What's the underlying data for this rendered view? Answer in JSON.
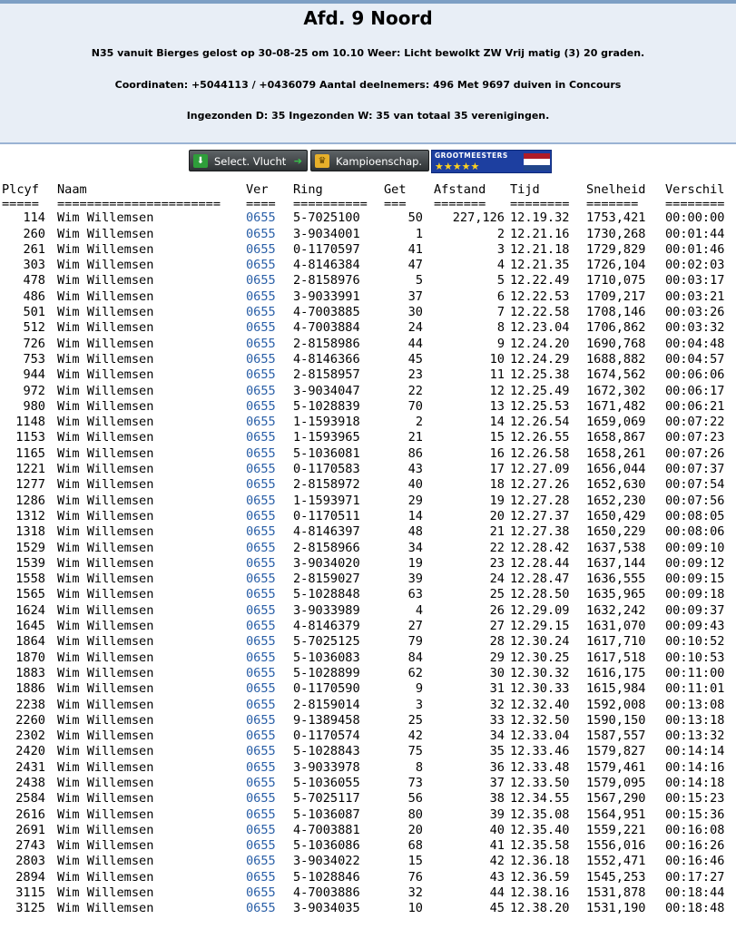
{
  "header": {
    "title": "Afd. 9 Noord",
    "line1": "N35 vanuit Bierges gelost op 30-08-25 om 10.10 Weer: Licht bewolkt ZW Vrij matig (3) 20 graden.",
    "line2": "Coordinaten: +5044113 / +0436079 Aantal deelnemers: 496 Met 9697 duiven in Concours",
    "line3": "Ingezonden D: 35 Ingezonden W: 35 van totaal 35 verenigingen."
  },
  "buttons": {
    "select": "Select. Vlucht",
    "kamp": "Kampioenschap.",
    "grootmeesters": "GROOTMEESTERS",
    "stars": "★★★★★"
  },
  "colors": {
    "header_bg": "#e8eef6",
    "ver_link": "#2a5fa7",
    "flag": [
      "#ae1c28",
      "#ffffff",
      "#21468b"
    ]
  },
  "table": {
    "headers": [
      "Plcyf",
      "Naam",
      "Ver",
      "Ring",
      "Get",
      "Afstand",
      "Tijd",
      "Snelheid",
      "Verschil"
    ],
    "separators": [
      "=====",
      "======================",
      "====",
      "==========",
      "===",
      "=======",
      "========",
      "=======",
      "========"
    ],
    "rows": [
      [
        "114",
        "Wim Willemsen",
        "0655",
        "5-7025100",
        "50",
        "227,126",
        "12.19.32",
        "1753,421",
        "00:00:00"
      ],
      [
        "260",
        "Wim Willemsen",
        "0655",
        "3-9034001",
        "1",
        "2",
        "12.21.16",
        "1730,268",
        "00:01:44"
      ],
      [
        "261",
        "Wim Willemsen",
        "0655",
        "0-1170597",
        "41",
        "3",
        "12.21.18",
        "1729,829",
        "00:01:46"
      ],
      [
        "303",
        "Wim Willemsen",
        "0655",
        "4-8146384",
        "47",
        "4",
        "12.21.35",
        "1726,104",
        "00:02:03"
      ],
      [
        "478",
        "Wim Willemsen",
        "0655",
        "2-8158976",
        "5",
        "5",
        "12.22.49",
        "1710,075",
        "00:03:17"
      ],
      [
        "486",
        "Wim Willemsen",
        "0655",
        "3-9033991",
        "37",
        "6",
        "12.22.53",
        "1709,217",
        "00:03:21"
      ],
      [
        "501",
        "Wim Willemsen",
        "0655",
        "4-7003885",
        "30",
        "7",
        "12.22.58",
        "1708,146",
        "00:03:26"
      ],
      [
        "512",
        "Wim Willemsen",
        "0655",
        "4-7003884",
        "24",
        "8",
        "12.23.04",
        "1706,862",
        "00:03:32"
      ],
      [
        "726",
        "Wim Willemsen",
        "0655",
        "2-8158986",
        "44",
        "9",
        "12.24.20",
        "1690,768",
        "00:04:48"
      ],
      [
        "753",
        "Wim Willemsen",
        "0655",
        "4-8146366",
        "45",
        "10",
        "12.24.29",
        "1688,882",
        "00:04:57"
      ],
      [
        "944",
        "Wim Willemsen",
        "0655",
        "2-8158957",
        "23",
        "11",
        "12.25.38",
        "1674,562",
        "00:06:06"
      ],
      [
        "972",
        "Wim Willemsen",
        "0655",
        "3-9034047",
        "22",
        "12",
        "12.25.49",
        "1672,302",
        "00:06:17"
      ],
      [
        "980",
        "Wim Willemsen",
        "0655",
        "5-1028839",
        "70",
        "13",
        "12.25.53",
        "1671,482",
        "00:06:21"
      ],
      [
        "1148",
        "Wim Willemsen",
        "0655",
        "1-1593918",
        "2",
        "14",
        "12.26.54",
        "1659,069",
        "00:07:22"
      ],
      [
        "1153",
        "Wim Willemsen",
        "0655",
        "1-1593965",
        "21",
        "15",
        "12.26.55",
        "1658,867",
        "00:07:23"
      ],
      [
        "1165",
        "Wim Willemsen",
        "0655",
        "5-1036081",
        "86",
        "16",
        "12.26.58",
        "1658,261",
        "00:07:26"
      ],
      [
        "1221",
        "Wim Willemsen",
        "0655",
        "0-1170583",
        "43",
        "17",
        "12.27.09",
        "1656,044",
        "00:07:37"
      ],
      [
        "1277",
        "Wim Willemsen",
        "0655",
        "2-8158972",
        "40",
        "18",
        "12.27.26",
        "1652,630",
        "00:07:54"
      ],
      [
        "1286",
        "Wim Willemsen",
        "0655",
        "1-1593971",
        "29",
        "19",
        "12.27.28",
        "1652,230",
        "00:07:56"
      ],
      [
        "1312",
        "Wim Willemsen",
        "0655",
        "0-1170511",
        "14",
        "20",
        "12.27.37",
        "1650,429",
        "00:08:05"
      ],
      [
        "1318",
        "Wim Willemsen",
        "0655",
        "4-8146397",
        "48",
        "21",
        "12.27.38",
        "1650,229",
        "00:08:06"
      ],
      [
        "1529",
        "Wim Willemsen",
        "0655",
        "2-8158966",
        "34",
        "22",
        "12.28.42",
        "1637,538",
        "00:09:10"
      ],
      [
        "1539",
        "Wim Willemsen",
        "0655",
        "3-9034020",
        "19",
        "23",
        "12.28.44",
        "1637,144",
        "00:09:12"
      ],
      [
        "1558",
        "Wim Willemsen",
        "0655",
        "2-8159027",
        "39",
        "24",
        "12.28.47",
        "1636,555",
        "00:09:15"
      ],
      [
        "1565",
        "Wim Willemsen",
        "0655",
        "5-1028848",
        "63",
        "25",
        "12.28.50",
        "1635,965",
        "00:09:18"
      ],
      [
        "1624",
        "Wim Willemsen",
        "0655",
        "3-9033989",
        "4",
        "26",
        "12.29.09",
        "1632,242",
        "00:09:37"
      ],
      [
        "1645",
        "Wim Willemsen",
        "0655",
        "4-8146379",
        "27",
        "27",
        "12.29.15",
        "1631,070",
        "00:09:43"
      ],
      [
        "1864",
        "Wim Willemsen",
        "0655",
        "5-7025125",
        "79",
        "28",
        "12.30.24",
        "1617,710",
        "00:10:52"
      ],
      [
        "1870",
        "Wim Willemsen",
        "0655",
        "5-1036083",
        "84",
        "29",
        "12.30.25",
        "1617,518",
        "00:10:53"
      ],
      [
        "1883",
        "Wim Willemsen",
        "0655",
        "5-1028899",
        "62",
        "30",
        "12.30.32",
        "1616,175",
        "00:11:00"
      ],
      [
        "1886",
        "Wim Willemsen",
        "0655",
        "0-1170590",
        "9",
        "31",
        "12.30.33",
        "1615,984",
        "00:11:01"
      ],
      [
        "2238",
        "Wim Willemsen",
        "0655",
        "2-8159014",
        "3",
        "32",
        "12.32.40",
        "1592,008",
        "00:13:08"
      ],
      [
        "2260",
        "Wim Willemsen",
        "0655",
        "9-1389458",
        "25",
        "33",
        "12.32.50",
        "1590,150",
        "00:13:18"
      ],
      [
        "2302",
        "Wim Willemsen",
        "0655",
        "0-1170574",
        "42",
        "34",
        "12.33.04",
        "1587,557",
        "00:13:32"
      ],
      [
        "2420",
        "Wim Willemsen",
        "0655",
        "5-1028843",
        "75",
        "35",
        "12.33.46",
        "1579,827",
        "00:14:14"
      ],
      [
        "2431",
        "Wim Willemsen",
        "0655",
        "3-9033978",
        "8",
        "36",
        "12.33.48",
        "1579,461",
        "00:14:16"
      ],
      [
        "2438",
        "Wim Willemsen",
        "0655",
        "5-1036055",
        "73",
        "37",
        "12.33.50",
        "1579,095",
        "00:14:18"
      ],
      [
        "2584",
        "Wim Willemsen",
        "0655",
        "5-7025117",
        "56",
        "38",
        "12.34.55",
        "1567,290",
        "00:15:23"
      ],
      [
        "2616",
        "Wim Willemsen",
        "0655",
        "5-1036087",
        "80",
        "39",
        "12.35.08",
        "1564,951",
        "00:15:36"
      ],
      [
        "2691",
        "Wim Willemsen",
        "0655",
        "4-7003881",
        "20",
        "40",
        "12.35.40",
        "1559,221",
        "00:16:08"
      ],
      [
        "2743",
        "Wim Willemsen",
        "0655",
        "5-1036086",
        "68",
        "41",
        "12.35.58",
        "1556,016",
        "00:16:26"
      ],
      [
        "2803",
        "Wim Willemsen",
        "0655",
        "3-9034022",
        "15",
        "42",
        "12.36.18",
        "1552,471",
        "00:16:46"
      ],
      [
        "2894",
        "Wim Willemsen",
        "0655",
        "5-1028846",
        "76",
        "43",
        "12.36.59",
        "1545,253",
        "00:17:27"
      ],
      [
        "3115",
        "Wim Willemsen",
        "0655",
        "4-7003886",
        "32",
        "44",
        "12.38.16",
        "1531,878",
        "00:18:44"
      ],
      [
        "3125",
        "Wim Willemsen",
        "0655",
        "3-9034035",
        "10",
        "45",
        "12.38.20",
        "1531,190",
        "00:18:48"
      ]
    ]
  }
}
